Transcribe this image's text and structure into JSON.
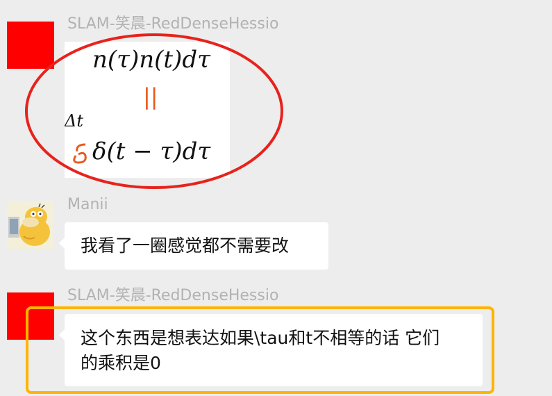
{
  "messages": [
    {
      "sender": "SLAM-笑晨-RedDenseHessio",
      "formula": {
        "top": "n(τ)n(t)dτ",
        "marker": "||",
        "delta_t": "Δt",
        "bottom": "δ(t − τ)dτ"
      }
    },
    {
      "sender": "Manii",
      "text": "我看了一圈感觉都不需要改"
    },
    {
      "sender": "SLAM-笑晨-RedDenseHessio",
      "lines": [
        "这个东西是想表达如果\\tau和t不相等的话 它们",
        "的乘积是0"
      ]
    }
  ],
  "annotations": {
    "circle_color": "#e8221c",
    "box_color": "#ffb400"
  },
  "colors": {
    "background": "#ededed",
    "avatar_red": "#ff0000",
    "sender_gray": "#b2b2b2"
  }
}
